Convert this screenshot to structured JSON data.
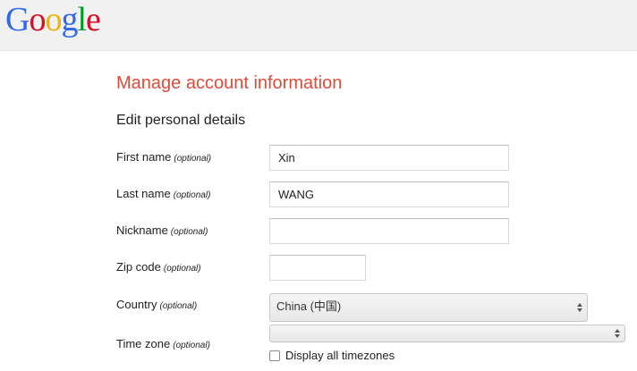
{
  "header": {
    "logo_letters": [
      "G",
      "o",
      "o",
      "g",
      "l",
      "e"
    ]
  },
  "page": {
    "title": "Manage account information",
    "section": "Edit personal details"
  },
  "form": {
    "optional": "(optional)",
    "first_name": {
      "label": "First name",
      "value": "Xin"
    },
    "last_name": {
      "label": "Last name",
      "value": "WANG"
    },
    "nickname": {
      "label": "Nickname",
      "value": ""
    },
    "zip_code": {
      "label": "Zip code",
      "value": ""
    },
    "country": {
      "label": "Country",
      "value": "China (中国)"
    },
    "time_zone": {
      "label": "Time zone",
      "value": ""
    },
    "display_all_timezones": {
      "label": "Display all timezones",
      "checked": false
    }
  }
}
